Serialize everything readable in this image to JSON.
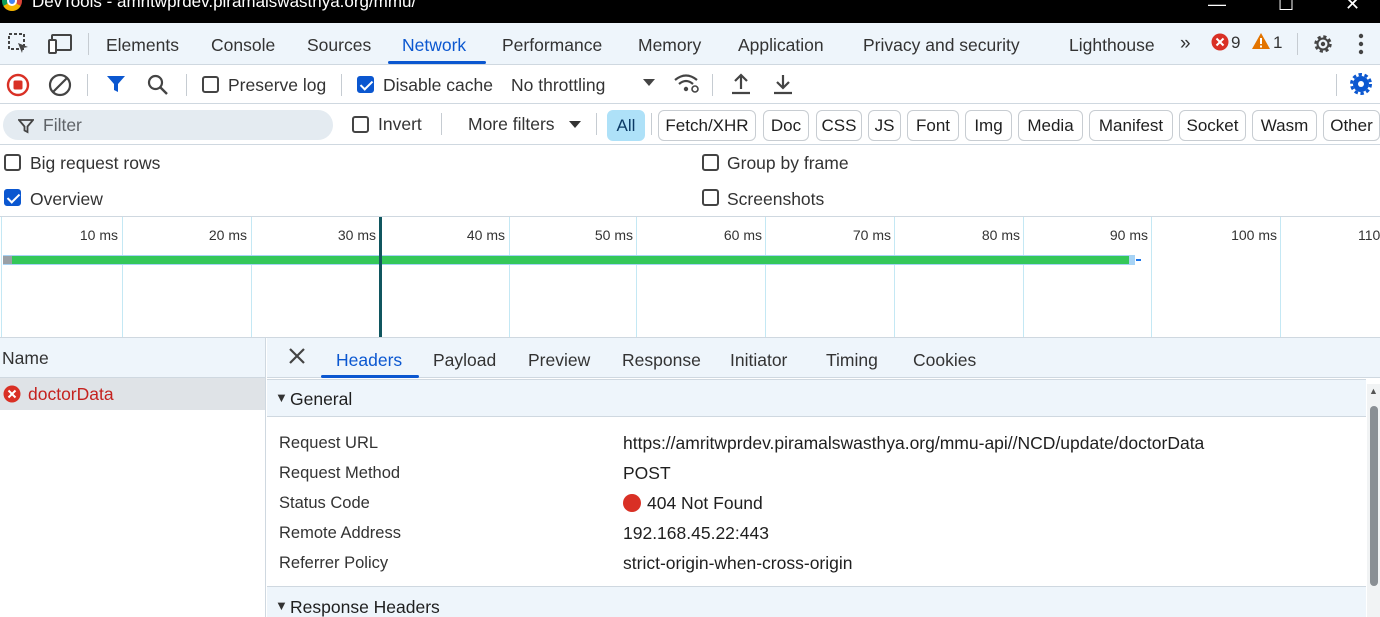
{
  "window": {
    "title": "DevTools - amritwprdev.piramalswasthya.org/mmu/"
  },
  "main_tabs": [
    {
      "label": "Elements"
    },
    {
      "label": "Console"
    },
    {
      "label": "Sources"
    },
    {
      "label": "Network"
    },
    {
      "label": "Performance"
    },
    {
      "label": "Memory"
    },
    {
      "label": "Application"
    },
    {
      "label": "Privacy and security"
    },
    {
      "label": "Lighthouse"
    }
  ],
  "active_main_tab": "Network",
  "issues": {
    "errors": "9",
    "warnings": "1",
    "more_tabs_icon": "chevrons-right-icon"
  },
  "toolbar": {
    "preserve_log_label": "Preserve log",
    "preserve_log_checked": false,
    "disable_cache_label": "Disable cache",
    "disable_cache_checked": true,
    "throttling_value": "No throttling"
  },
  "filter": {
    "placeholder": "Filter",
    "invert_label": "Invert",
    "more_filters_label": "More filters",
    "types": [
      "All",
      "Fetch/XHR",
      "Doc",
      "CSS",
      "JS",
      "Font",
      "Img",
      "Media",
      "Manifest",
      "Socket",
      "Wasm",
      "Other"
    ],
    "active_type": "All"
  },
  "options": {
    "big_request_rows": "Big request rows",
    "group_by_frame": "Group by frame",
    "overview": "Overview",
    "screenshots": "Screenshots"
  },
  "timeline": {
    "ticks": [
      "10 ms",
      "20 ms",
      "30 ms",
      "40 ms",
      "50 ms",
      "60 ms",
      "70 ms",
      "80 ms",
      "90 ms",
      "100 ms",
      "110"
    ]
  },
  "requests": {
    "column_header": "Name",
    "items": [
      {
        "name": "doctorData",
        "status": "error"
      }
    ]
  },
  "detail": {
    "tabs": [
      "Headers",
      "Payload",
      "Preview",
      "Response",
      "Initiator",
      "Timing",
      "Cookies"
    ],
    "active_tab": "Headers",
    "general_title": "General",
    "general": [
      {
        "key": "Request URL",
        "value": "https://amritwprdev.piramalswasthya.org/mmu-api//NCD/update/doctorData"
      },
      {
        "key": "Request Method",
        "value": "POST"
      },
      {
        "key": "Status Code",
        "value": "404 Not Found"
      },
      {
        "key": "Remote Address",
        "value": "192.168.45.22:443"
      },
      {
        "key": "Referrer Policy",
        "value": "strict-origin-when-cross-origin"
      }
    ],
    "response_headers_title": "Response Headers"
  },
  "colors": {
    "accent": "#0b57d0",
    "error": "#d93025",
    "warning": "#e37400",
    "bar": "#34c759"
  }
}
